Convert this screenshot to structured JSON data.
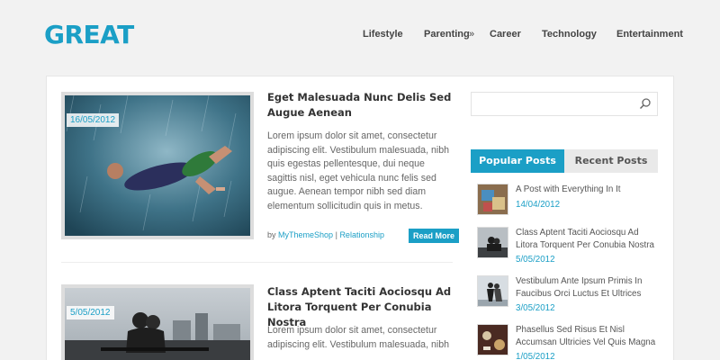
{
  "header": {
    "logo": "GREAT",
    "nav": [
      {
        "label": "Lifestyle"
      },
      {
        "label": "Parenting",
        "has_submenu": true,
        "indicator": "»"
      },
      {
        "label": "Career"
      },
      {
        "label": "Technology"
      },
      {
        "label": "Entertainment"
      }
    ]
  },
  "posts": [
    {
      "date": "16/05/2012",
      "title": "Eget Malesuada Nunc Delis Sed Augue Aenean",
      "excerpt": "Lorem ipsum dolor sit amet, consectetur adipiscing elit. Vestibulum malesuada, nibh quis egestas pellentesque, dui neque sagittis nisl, eget vehicula nunc felis sed augue. Aenean tempor nibh sed diam elementum sollicitudin quis in metus.",
      "meta_by": "by",
      "author": "MyThemeShop",
      "meta_sep": "|",
      "category": "Relationship",
      "read_more": "Read More"
    },
    {
      "date": "5/05/2012",
      "title": "Class Aptent Taciti Aociosqu Ad Litora Torquent Per Conubia Nostra",
      "excerpt": "Lorem ipsum dolor sit amet, consectetur adipiscing elit. Vestibulum malesuada, nibh"
    }
  ],
  "sidebar": {
    "search": {
      "placeholder": "",
      "icon": "search-icon"
    },
    "tabs": [
      {
        "label": "Popular Posts",
        "active": true
      },
      {
        "label": "Recent Posts",
        "active": false
      }
    ],
    "popular_posts": [
      {
        "title": "A Post with Everything In It",
        "date": "14/04/2012"
      },
      {
        "title": "Class Aptent Taciti Aociosqu Ad Litora Torquent Per Conubia Nostra",
        "date": "5/05/2012"
      },
      {
        "title": "Vestibulum Ante Ipsum Primis In Faucibus Orci Luctus Et Ultrices",
        "date": "3/05/2012"
      },
      {
        "title": "Phasellus Sed Risus Et Nisl Accumsan Ultricies Vel Quis Magna",
        "date": "1/05/2012"
      }
    ]
  },
  "colors": {
    "accent": "#1b9fc6",
    "background": "#f2f2f2",
    "panel": "#ffffff",
    "text": "#555555"
  }
}
